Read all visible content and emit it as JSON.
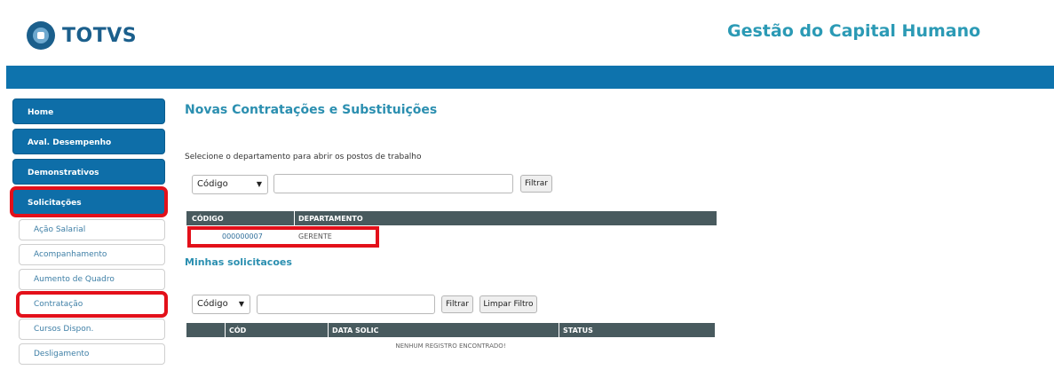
{
  "header": {
    "logo_text": "TOTVS",
    "app_title": "Gestão do Capital Humano"
  },
  "sidebar": {
    "main": [
      {
        "label": "Home"
      },
      {
        "label": "Aval. Desempenho"
      },
      {
        "label": "Demonstrativos"
      },
      {
        "label": "Solicitações"
      }
    ],
    "sub": [
      {
        "label": "Ação Salarial"
      },
      {
        "label": "Acompanhamento"
      },
      {
        "label": "Aumento de Quadro"
      },
      {
        "label": "Contratação"
      },
      {
        "label": "Cursos Dispon."
      },
      {
        "label": "Desligamento"
      }
    ]
  },
  "main": {
    "title": "Novas Contratações e Substituições",
    "instruction": "Selecione o departamento para abrir os postos de trabalho",
    "filter1": {
      "select_value": "Código",
      "input_value": "",
      "filter_label": "Filtrar"
    },
    "dept_table": {
      "headers": [
        "CÓDIGO",
        "DEPARTAMENTO"
      ],
      "rows": [
        {
          "codigo": "000000007",
          "departamento": "GERENTE"
        }
      ]
    },
    "section2_title": "Minhas solicitacoes",
    "filter2": {
      "select_value": "Código",
      "input_value": "",
      "filter_label": "Filtrar",
      "clear_label": "Limpar Filtro"
    },
    "req_table": {
      "headers": [
        "",
        "CÓD",
        "DATA SOLIC",
        "STATUS"
      ],
      "empty_message": "NENHUM REGISTRO ENCONTRADO!"
    }
  },
  "colors": {
    "brand_blue": "#0e73ad",
    "title_teal": "#2b9ab5",
    "grid_header": "#485a5e",
    "highlight_red": "#e3101a"
  }
}
